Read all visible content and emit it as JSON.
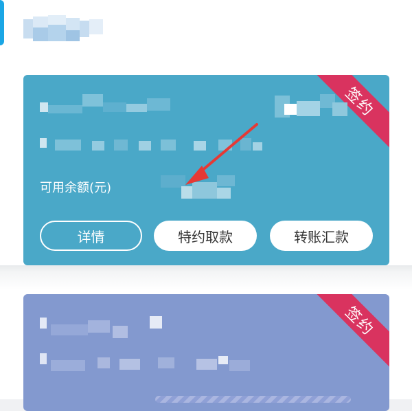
{
  "colors": {
    "accent_blue": "#1aa6e5",
    "card1_bg": "#4aa8c8",
    "card2_bg": "#8399cf",
    "ribbon": "#d9335f"
  },
  "cards": [
    {
      "badge": "签约",
      "balance_label": "可用余额(元)",
      "buttons": {
        "detail": "详情",
        "withdraw": "特约取款",
        "transfer": "转账汇款"
      }
    },
    {
      "badge": "签约"
    }
  ]
}
